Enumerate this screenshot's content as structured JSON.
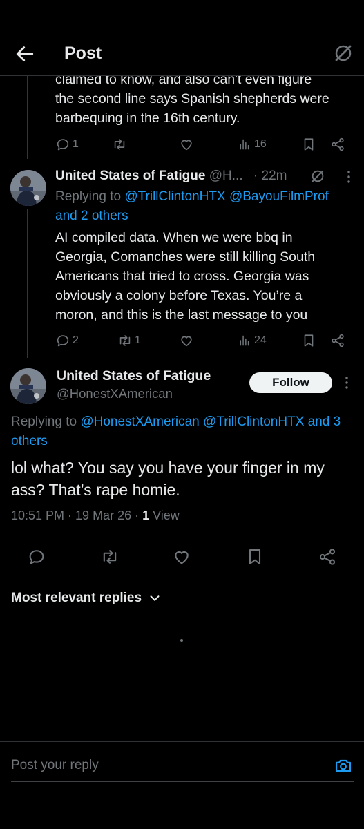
{
  "header": {
    "title": "Post"
  },
  "parent_reply": {
    "text_line1": "claimed to know, and also can't even figure",
    "text_line2": "the second line says Spanish shepherds were",
    "text_line3": "barbequing in the 16th century.",
    "replies": "1",
    "views": "16"
  },
  "reply2": {
    "display_name": "United States of Fatigue",
    "handle": "@H...",
    "time": "· 22m",
    "replying_prefix": "Replying to",
    "replying_1": "@TrillClintonHTX",
    "replying_2": "@BayouFilmProf",
    "replying_3": "and 2 others",
    "text_line1": "AI compiled data. When we were bbq in",
    "text_line2": "Georgia, Comanches were still killing South",
    "text_line3": "Americans that tried to cross. Georgia was",
    "text_line4": "obviously a colony before Texas. You’re a",
    "text_line5": "moron, and this is the last message to you",
    "replies": "2",
    "reposts": "1",
    "views": "24"
  },
  "main_post": {
    "display_name": "United States of Fatigue",
    "handle": "@HonestXAmerican",
    "follow_label": "Follow",
    "replying_prefix": "Replying to",
    "replying_1": "@HonestXAmerican",
    "replying_2": "@TrillClintonHTX",
    "replying_3": "and 3",
    "replying_4": "others",
    "text": "lol what? You say you have your finger in my ass? That’s rape homie.",
    "timestamp": "10:51 PM · 19 Mar 26 · ",
    "view_count": "1",
    "view_label": " View"
  },
  "replies_sort": {
    "label": "Most relevant replies"
  },
  "reply_box": {
    "placeholder": "Post your reply"
  },
  "colors": {
    "background": "#000000",
    "text": "#e7e9ea",
    "muted": "#71767b",
    "link": "#1d9bf0",
    "divider": "#2f3336"
  },
  "icons": [
    "back-arrow-icon",
    "grok-icon",
    "reply-icon",
    "repost-icon",
    "like-icon",
    "views-icon",
    "bookmark-icon",
    "share-icon",
    "more-icon",
    "chevron-down-icon",
    "camera-icon"
  ]
}
